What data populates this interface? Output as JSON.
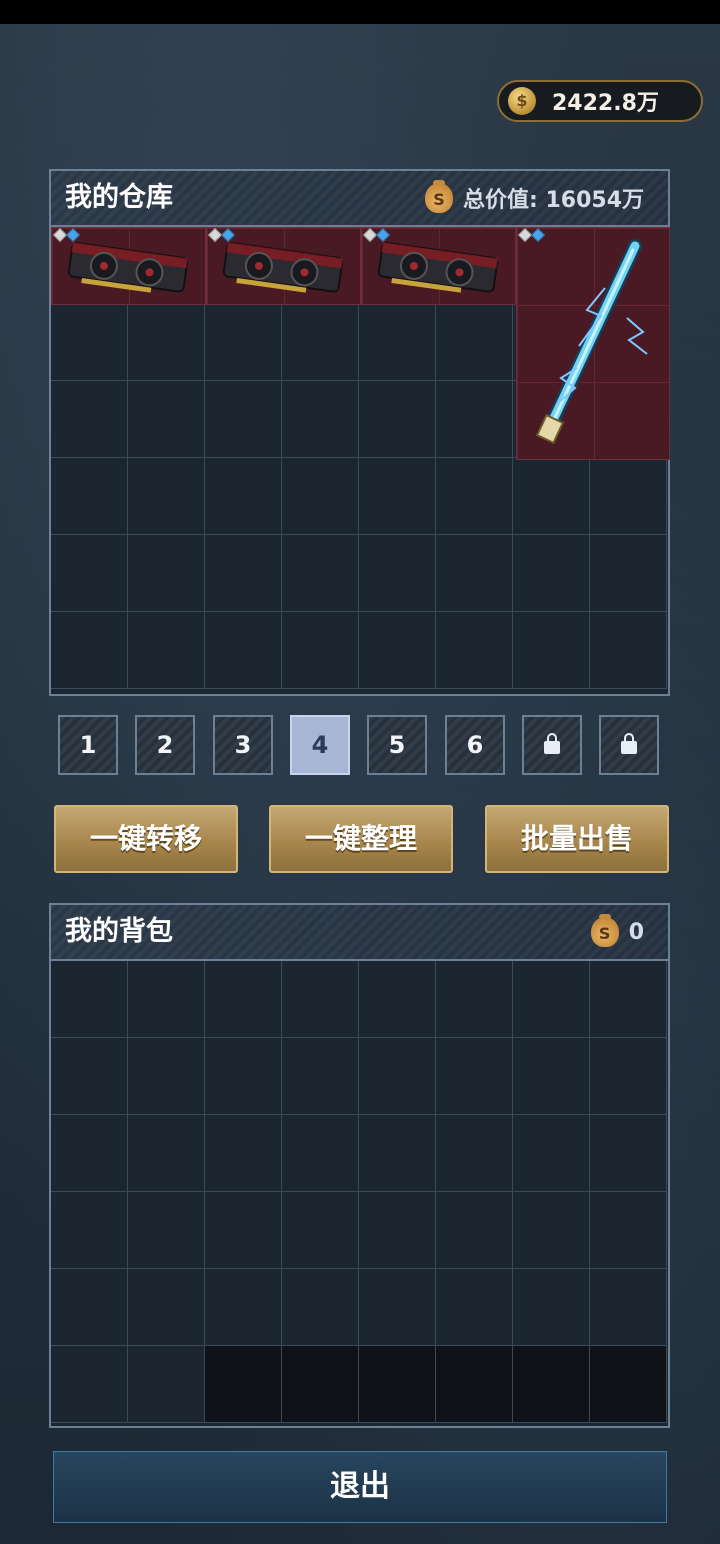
{
  "currency": {
    "icon": "coin-icon",
    "amount": "2422.8万"
  },
  "warehouse": {
    "title": "我的仓库",
    "value_label": "总价值: 16054万",
    "items": [
      {
        "name": "graphics-card",
        "icon": "graphics-card-icon",
        "quality": "red"
      },
      {
        "name": "graphics-card",
        "icon": "graphics-card-icon",
        "quality": "red"
      },
      {
        "name": "graphics-card",
        "icon": "graphics-card-icon",
        "quality": "red"
      },
      {
        "name": "lightning-rod",
        "icon": "lightning-rod-icon",
        "quality": "red"
      }
    ]
  },
  "tabs": {
    "items": [
      {
        "label": "1",
        "locked": false
      },
      {
        "label": "2",
        "locked": false
      },
      {
        "label": "3",
        "locked": false
      },
      {
        "label": "4",
        "locked": false,
        "active": true
      },
      {
        "label": "5",
        "locked": false
      },
      {
        "label": "6",
        "locked": false
      },
      {
        "label": "",
        "locked": true
      },
      {
        "label": "",
        "locked": true
      }
    ]
  },
  "actions": {
    "transfer_all": "一键转移",
    "auto_sort": "一键整理",
    "bulk_sell": "批量出售"
  },
  "backpack": {
    "title": "我的背包",
    "value": "0"
  },
  "exit_label": "退出",
  "colors": {
    "item_quality_red": "#4a1a24",
    "active_tab": "#a8b6d6",
    "gold_button": "#a8874d",
    "panel_border": "#6c8096"
  }
}
